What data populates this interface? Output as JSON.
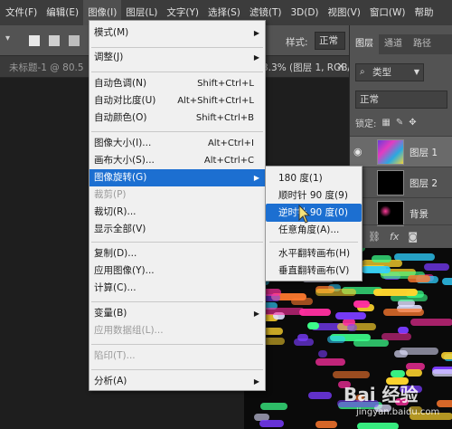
{
  "menubar": {
    "items": [
      "文件(F)",
      "编辑(E)",
      "图像(I)",
      "图层(L)",
      "文字(Y)",
      "选择(S)",
      "滤镜(T)",
      "3D(D)",
      "视图(V)",
      "窗口(W)",
      "帮助"
    ],
    "active_index": 2
  },
  "options": {
    "style_label": "样式:",
    "style_value": "正常"
  },
  "doc_tab": {
    "title_left": "未标题-1 @ 80.5",
    "title_right": "3.3% (图层 1, RGB/",
    "close": "×"
  },
  "layers_panel": {
    "tabs": [
      "图层",
      "通道",
      "路径"
    ],
    "kind": "类型",
    "blend_mode": "正常",
    "lock_label": "锁定:",
    "layers": [
      {
        "name": "图层 1",
        "selected": true
      },
      {
        "name": "图层 2",
        "selected": false
      },
      {
        "name": "背景",
        "selected": false
      }
    ],
    "bottom_icons": [
      "link-icon",
      "fx-icon",
      "mask-icon"
    ]
  },
  "image_menu": {
    "items": [
      {
        "label": "模式(M)",
        "shortcut": "",
        "submenu": true,
        "disabled": false,
        "highlighted": false
      },
      {
        "label": "调整(J)",
        "shortcut": "",
        "submenu": true,
        "disabled": false,
        "highlighted": false
      },
      {
        "label": "自动色调(N)",
        "shortcut": "Shift+Ctrl+L",
        "submenu": false,
        "disabled": false,
        "highlighted": false
      },
      {
        "label": "自动对比度(U)",
        "shortcut": "Alt+Shift+Ctrl+L",
        "submenu": false,
        "disabled": false,
        "highlighted": false
      },
      {
        "label": "自动颜色(O)",
        "shortcut": "Shift+Ctrl+B",
        "submenu": false,
        "disabled": false,
        "highlighted": false
      },
      {
        "label": "图像大小(I)...",
        "shortcut": "Alt+Ctrl+I",
        "submenu": false,
        "disabled": false,
        "highlighted": false
      },
      {
        "label": "画布大小(S)...",
        "shortcut": "Alt+Ctrl+C",
        "submenu": false,
        "disabled": false,
        "highlighted": false
      },
      {
        "label": "图像旋转(G)",
        "shortcut": "",
        "submenu": true,
        "disabled": false,
        "highlighted": true
      },
      {
        "label": "裁剪(P)",
        "shortcut": "",
        "submenu": false,
        "disabled": true,
        "highlighted": false
      },
      {
        "label": "裁切(R)...",
        "shortcut": "",
        "submenu": false,
        "disabled": false,
        "highlighted": false
      },
      {
        "label": "显示全部(V)",
        "shortcut": "",
        "submenu": false,
        "disabled": false,
        "highlighted": false
      },
      {
        "label": "复制(D)...",
        "shortcut": "",
        "submenu": false,
        "disabled": false,
        "highlighted": false
      },
      {
        "label": "应用图像(Y)...",
        "shortcut": "",
        "submenu": false,
        "disabled": false,
        "highlighted": false
      },
      {
        "label": "计算(C)...",
        "shortcut": "",
        "submenu": false,
        "disabled": false,
        "highlighted": false
      },
      {
        "label": "变量(B)",
        "shortcut": "",
        "submenu": true,
        "disabled": false,
        "highlighted": false
      },
      {
        "label": "应用数据组(L)...",
        "shortcut": "",
        "submenu": false,
        "disabled": true,
        "highlighted": false
      },
      {
        "label": "陷印(T)...",
        "shortcut": "",
        "submenu": false,
        "disabled": true,
        "highlighted": false
      },
      {
        "label": "分析(A)",
        "shortcut": "",
        "submenu": true,
        "disabled": false,
        "highlighted": false
      }
    ]
  },
  "rotate_submenu": {
    "items": [
      {
        "label": "180 度(1)",
        "highlighted": false
      },
      {
        "label": "顺时针 90 度(9)",
        "highlighted": false
      },
      {
        "label": "逆时针 90 度(0)",
        "highlighted": true
      },
      {
        "label": "任意角度(A)...",
        "highlighted": false
      },
      {
        "label": "水平翻转画布(H)",
        "highlighted": false
      },
      {
        "label": "垂直翻转画布(V)",
        "highlighted": false
      }
    ]
  },
  "watermark": {
    "logo": "Bai 经验",
    "url": "jingyan.baidu.com"
  },
  "colors": {
    "menu_highlight": "#1c6fd1",
    "menu_bg": "#f0f0f0",
    "panel_bg": "#535353",
    "menubar_bg": "#3c3c3c"
  }
}
